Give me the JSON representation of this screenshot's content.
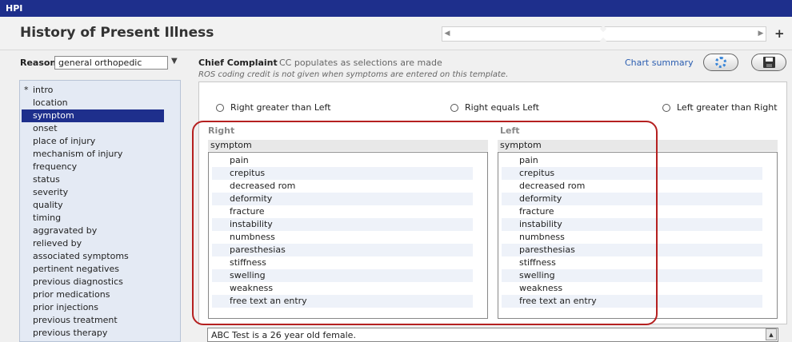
{
  "window": {
    "title": "HPI"
  },
  "header": {
    "title": "History of Present Illness"
  },
  "reason": {
    "label": "Reason:",
    "value": "general orthopedic"
  },
  "sidebar": {
    "items": [
      {
        "label": "intro",
        "starred": true
      },
      {
        "label": "location"
      },
      {
        "label": "symptom",
        "active": true
      },
      {
        "label": "onset"
      },
      {
        "label": "place of injury"
      },
      {
        "label": "mechanism of injury"
      },
      {
        "label": "frequency"
      },
      {
        "label": "status"
      },
      {
        "label": "severity"
      },
      {
        "label": "quality"
      },
      {
        "label": "timing"
      },
      {
        "label": "aggravated by"
      },
      {
        "label": "relieved by"
      },
      {
        "label": "associated symptoms"
      },
      {
        "label": "pertinent negatives"
      },
      {
        "label": "previous diagnostics"
      },
      {
        "label": "prior medications"
      },
      {
        "label": "prior injections"
      },
      {
        "label": "previous treatment"
      },
      {
        "label": "previous therapy"
      }
    ]
  },
  "chief_complaint": {
    "label": "Chief Complaint",
    "hint": "CC populates as selections are made",
    "ros_note": "ROS coding credit is not given when symptoms are entered on this template.",
    "chart_summary": "Chart summary"
  },
  "comparison": {
    "options": [
      "Right greater than Left",
      "Right equals Left",
      "Left greater than Right"
    ]
  },
  "right": {
    "title": "Right",
    "subtitle": "symptom",
    "items": [
      "pain",
      "crepitus",
      "decreased rom",
      "deformity",
      "fracture",
      "instability",
      "numbness",
      "paresthesias",
      "stiffness",
      "swelling",
      "weakness",
      "free text an entry"
    ]
  },
  "left": {
    "title": "Left",
    "subtitle": "symptom",
    "items": [
      "pain",
      "crepitus",
      "decreased rom",
      "deformity",
      "fracture",
      "instability",
      "numbness",
      "paresthesias",
      "stiffness",
      "swelling",
      "weakness",
      "free text an entry"
    ]
  },
  "note": {
    "text": "ABC Test is a 26 year old female."
  },
  "colors": {
    "titlebar": "#1e2f8c",
    "highlight": "#b52020",
    "link": "#2a5db0"
  }
}
